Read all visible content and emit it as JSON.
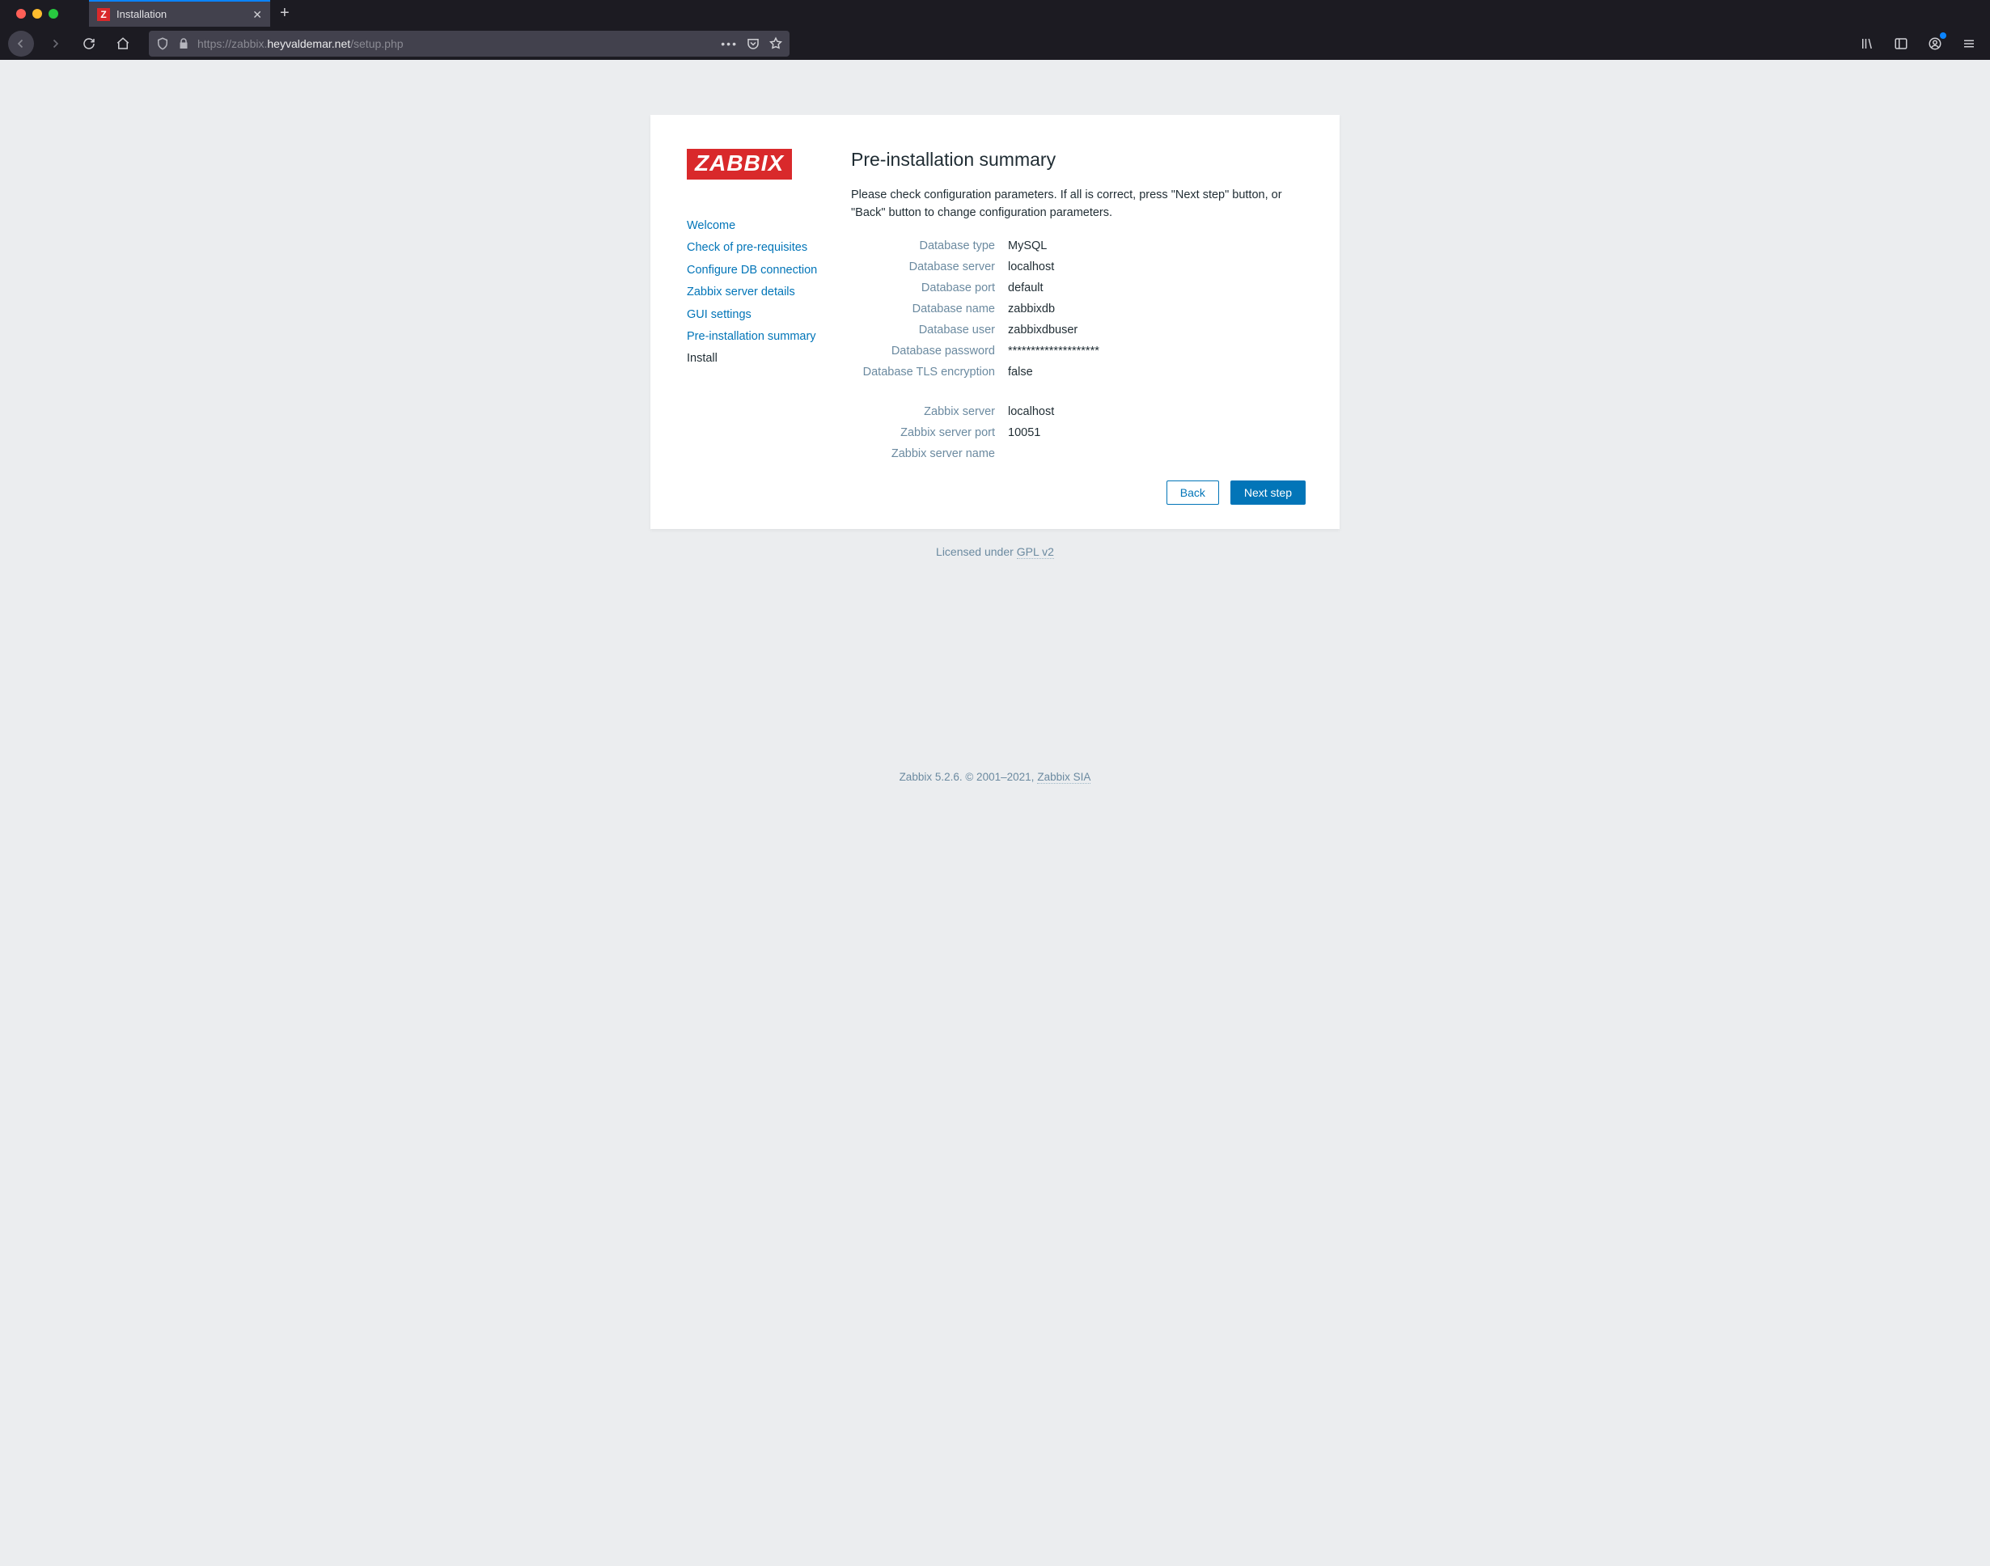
{
  "browser": {
    "tab_title": "Installation",
    "tab_favicon_letter": "Z",
    "url_scheme": "https://",
    "url_sub": "zabbix.",
    "url_host": "heyvaldemar.net",
    "url_path": "/setup.php"
  },
  "logo_text": "ZABBIX",
  "steps": [
    {
      "label": "Welcome",
      "state": "done"
    },
    {
      "label": "Check of pre-requisites",
      "state": "done"
    },
    {
      "label": "Configure DB connection",
      "state": "done"
    },
    {
      "label": "Zabbix server details",
      "state": "done"
    },
    {
      "label": "GUI settings",
      "state": "done"
    },
    {
      "label": "Pre-installation summary",
      "state": "done"
    },
    {
      "label": "Install",
      "state": "pending"
    }
  ],
  "main": {
    "heading": "Pre-installation summary",
    "intro": "Please check configuration parameters. If all is correct, press \"Next step\" button, or \"Back\" button to change configuration parameters.",
    "rows_db": [
      {
        "label": "Database type",
        "value": "MySQL"
      },
      {
        "label": "Database server",
        "value": "localhost"
      },
      {
        "label": "Database port",
        "value": "default"
      },
      {
        "label": "Database name",
        "value": "zabbixdb"
      },
      {
        "label": "Database user",
        "value": "zabbixdbuser"
      },
      {
        "label": "Database password",
        "value": "********************"
      },
      {
        "label": "Database TLS encryption",
        "value": "false"
      }
    ],
    "rows_server": [
      {
        "label": "Zabbix server",
        "value": "localhost"
      },
      {
        "label": "Zabbix server port",
        "value": "10051"
      },
      {
        "label": "Zabbix server name",
        "value": ""
      }
    ],
    "back_label": "Back",
    "next_label": "Next step"
  },
  "license": {
    "text": "Licensed under",
    "link": "GPL v2"
  },
  "footer": {
    "text": "Zabbix 5.2.6. © 2001–2021,",
    "link": "Zabbix SIA"
  }
}
